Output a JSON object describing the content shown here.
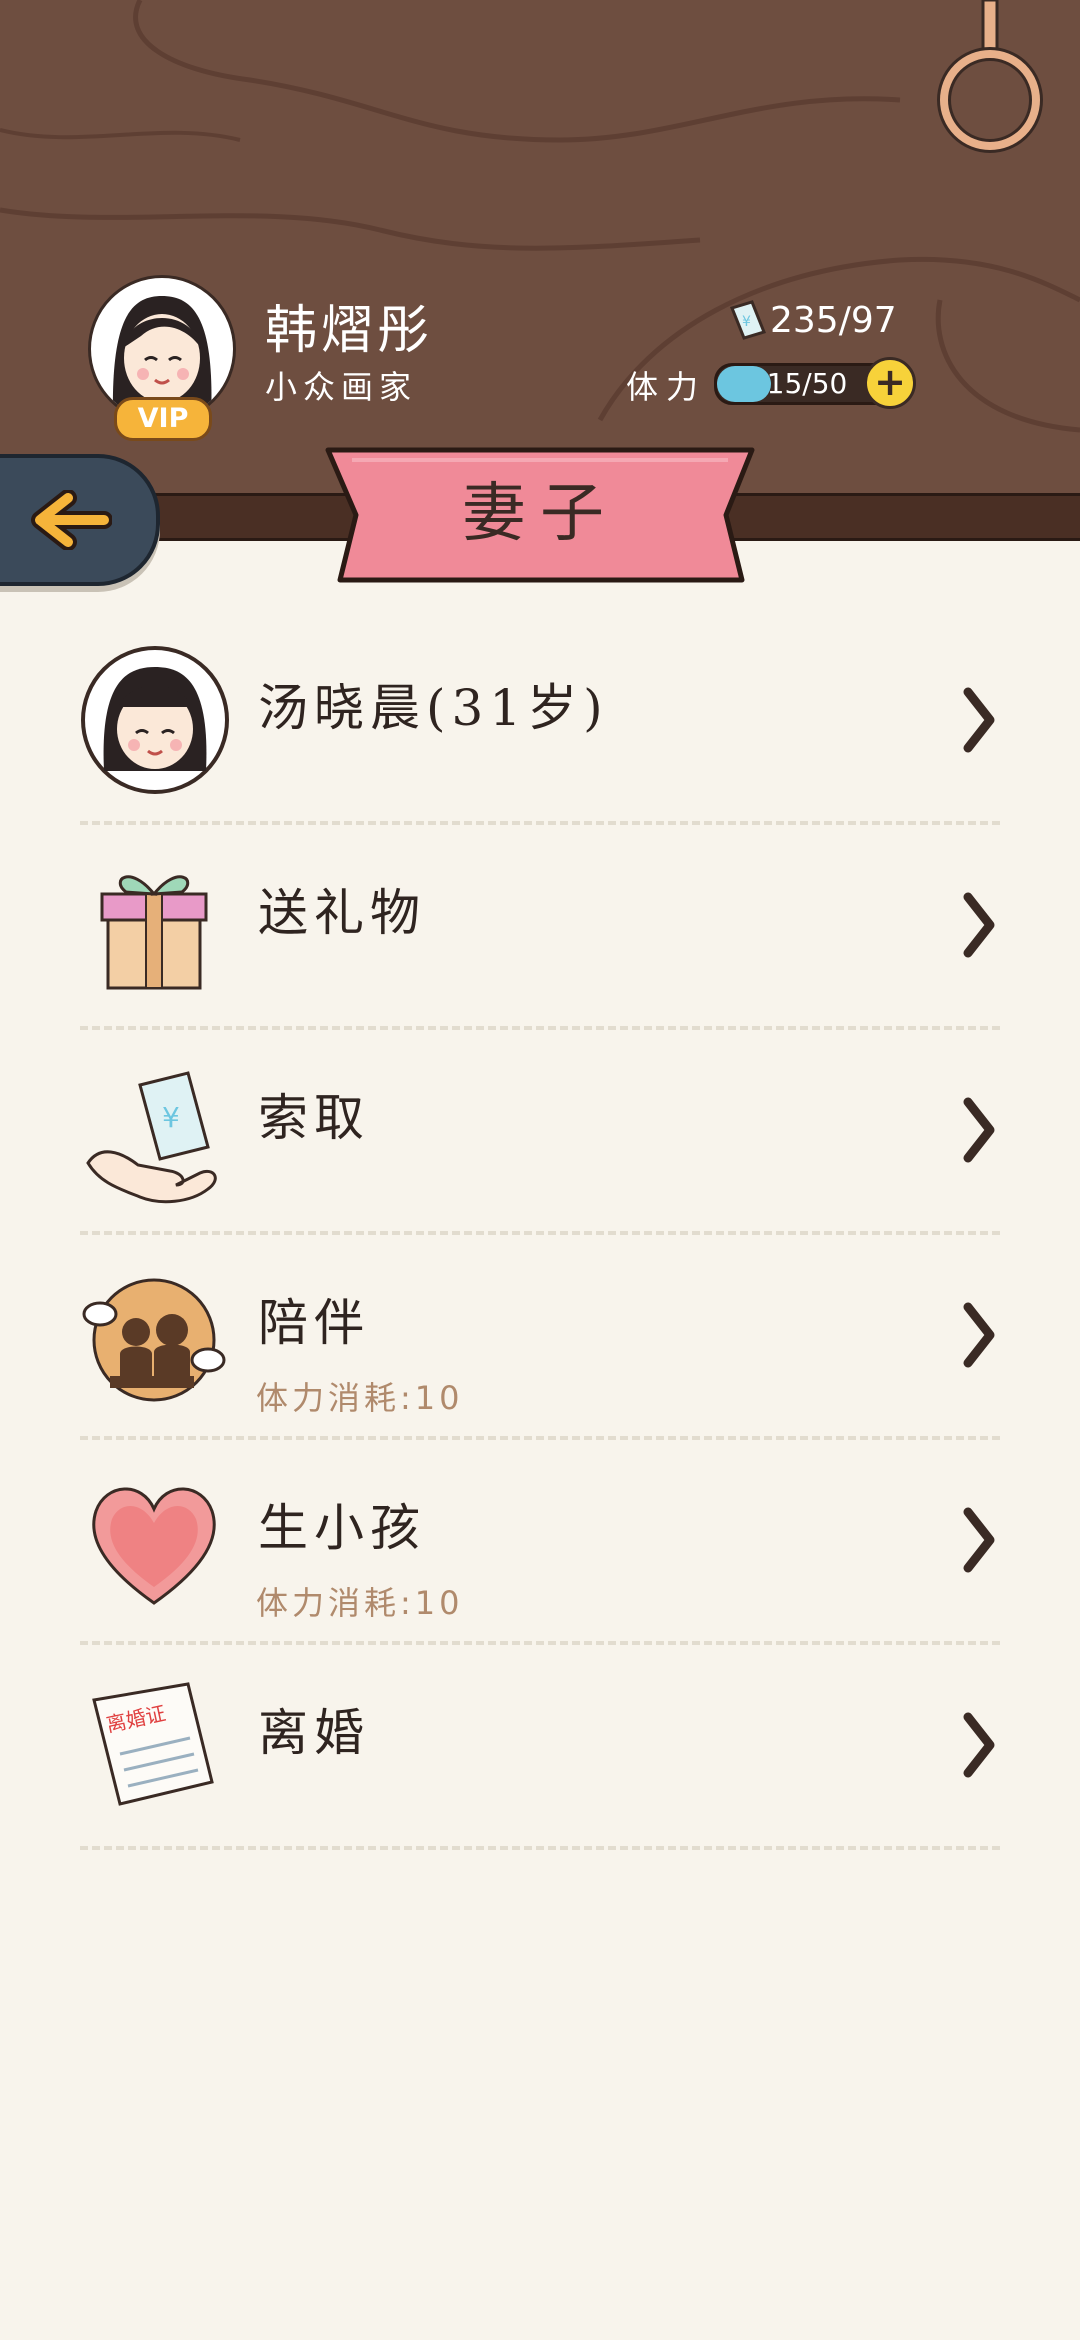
{
  "player": {
    "name": "韩熠彤",
    "title": "小众画家",
    "vip_label": "VIP",
    "money": "235/97",
    "stamina_label": "体力",
    "stamina": "15/50",
    "stamina_fraction": 0.3
  },
  "page_title": "妻子",
  "menu": [
    {
      "label": "汤晓晨(31岁)",
      "sub": ""
    },
    {
      "label": "送礼物",
      "sub": ""
    },
    {
      "label": "索取",
      "sub": ""
    },
    {
      "label": "陪伴",
      "sub": "体力消耗:10"
    },
    {
      "label": "生小孩",
      "sub": "体力消耗:10"
    },
    {
      "label": "离婚",
      "sub": ""
    }
  ],
  "divorce_certificate_text": "离婚证",
  "colors": {
    "header_brown": "#6e4e40",
    "banner_pink": "#f08a98",
    "background": "#f8f4ec",
    "stamina_blue": "#6cc6e0",
    "back_button": "#3b4a5a"
  }
}
